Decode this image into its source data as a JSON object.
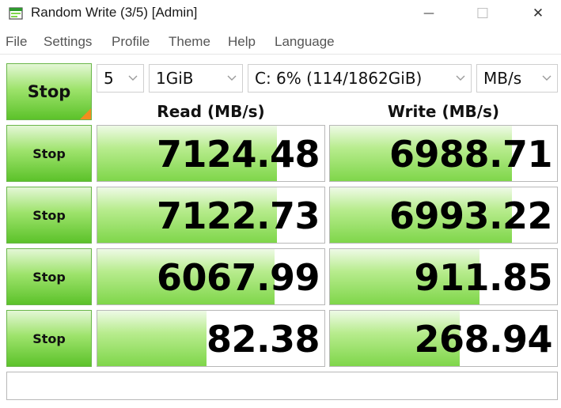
{
  "window": {
    "title": "Random Write (3/5) [Admin]",
    "minimize_glyph": "—",
    "maximize_glyph": "☐",
    "close_glyph": "✕"
  },
  "menu": [
    "File",
    "Settings",
    "Profile",
    "Theme",
    "Help",
    "Language"
  ],
  "controls": {
    "main_button": "Stop",
    "count": "5",
    "size": "1GiB",
    "drive": "C: 6% (114/1862GiB)",
    "unit": "MB/s"
  },
  "headers": {
    "read": "Read (MB/s)",
    "write": "Write (MB/s)"
  },
  "rows": [
    {
      "button": "Stop",
      "read": "7124.48",
      "read_fill": 0.79,
      "write": "6988.71",
      "write_fill": 0.8
    },
    {
      "button": "Stop",
      "read": "7122.73",
      "read_fill": 0.79,
      "write": "6993.22",
      "write_fill": 0.8
    },
    {
      "button": "Stop",
      "read": "6067.99",
      "read_fill": 0.78,
      "write": "911.85",
      "write_fill": 0.66
    },
    {
      "button": "Stop",
      "read": "82.38",
      "read_fill": 0.48,
      "write": "268.94",
      "write_fill": 0.57
    }
  ],
  "comment": "",
  "colors": {
    "accent_orange": "#f28c1e",
    "bar_green": "#7fd64a",
    "button_green": "#5cc22a"
  },
  "icons": {
    "app": "app-window-icon",
    "dropdown": "chevron-down-icon"
  }
}
